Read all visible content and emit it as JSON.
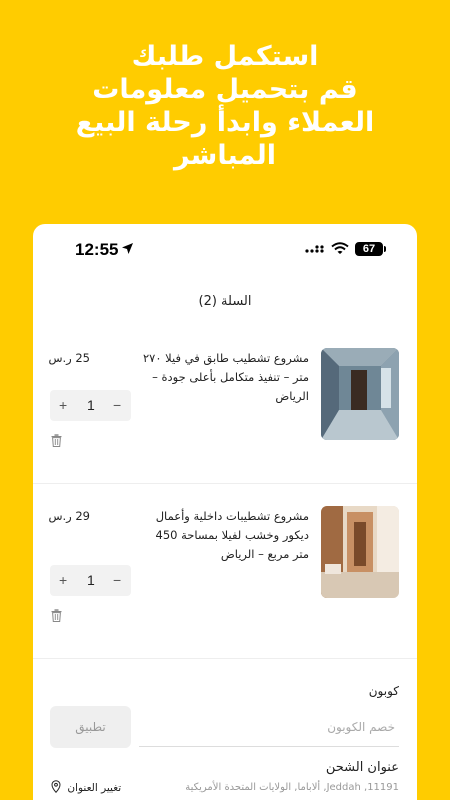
{
  "headline": [
    "استكمل طلبك",
    "قم بتحميل معلومات",
    "العملاء وابدأ رحلة البيع",
    "المباشر"
  ],
  "status_bar": {
    "time": "12:55",
    "battery": "67"
  },
  "cart": {
    "title": "السلة (2)",
    "items": [
      {
        "name": "مشروع تشطيب طابق في فيلا ٢٧٠ متر – تنفيذ متكامل بأعلى جودة – الرياض",
        "price": "25 ر.س",
        "quantity": "1",
        "plus": "+",
        "minus": "−"
      },
      {
        "name": "مشروع تشطيبات داخلية وأعمال ديكور وخشب لفيلا بمساحة 450 متر مربع – الرياض",
        "price": "29 ر.س",
        "quantity": "1",
        "plus": "+",
        "minus": "−"
      }
    ]
  },
  "coupon": {
    "label": "كوبون",
    "placeholder": "خصم الكوبون",
    "apply_label": "تطبيق"
  },
  "shipping": {
    "title": "عنوان الشحن",
    "address": "11191, Jeddah, ألاباما, الولايات المتحدة الأمريكية",
    "change_label": "تغيير العنوان"
  },
  "colors": {
    "background": "#FFCC00",
    "card": "#FFFFFF"
  }
}
